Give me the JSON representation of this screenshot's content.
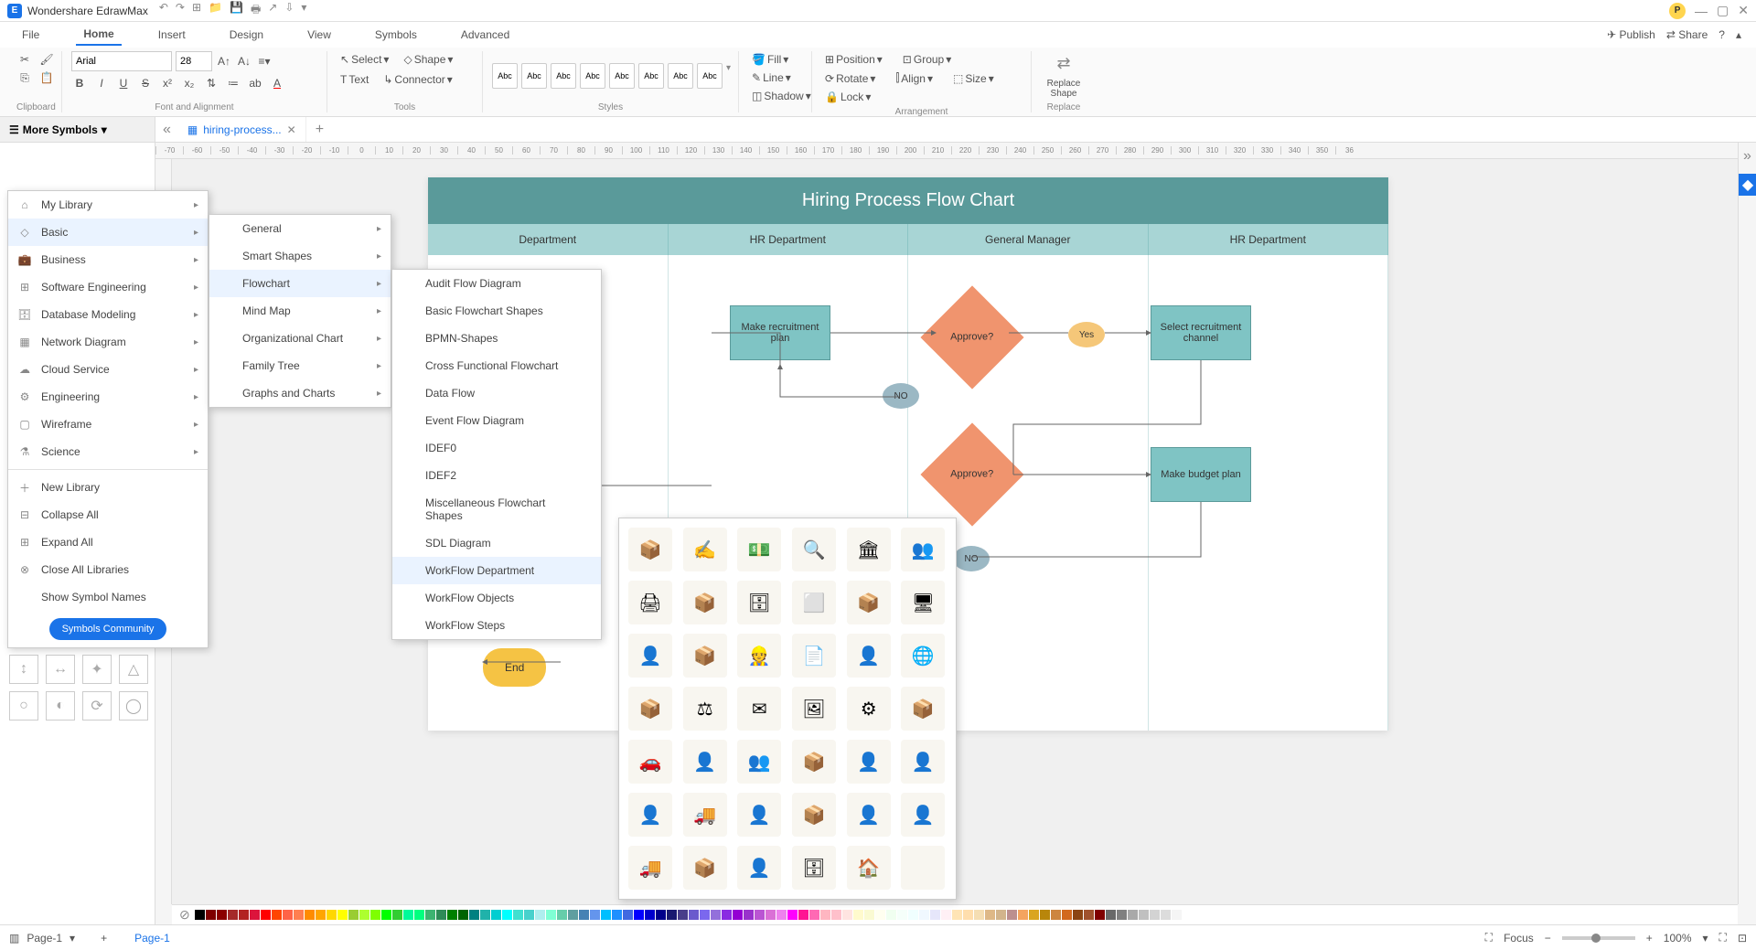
{
  "app_title": "Wondershare EdrawMax",
  "avatar_letter": "P",
  "menu_tabs": {
    "file": "File",
    "home": "Home",
    "insert": "Insert",
    "design": "Design",
    "view": "View",
    "symbols": "Symbols",
    "advanced": "Advanced",
    "publish": "Publish",
    "share": "Share"
  },
  "ribbon": {
    "clipboard": "Clipboard",
    "font_name": "Arial",
    "font_size": "28",
    "font_alignment": "Font and Alignment",
    "select": "Select",
    "shape": "Shape",
    "text": "Text",
    "connector": "Connector",
    "tools": "Tools",
    "abc": "Abc",
    "styles": "Styles",
    "fill": "Fill",
    "line": "Line",
    "shadow": "Shadow",
    "position": "Position",
    "align": "Align",
    "group": "Group",
    "size": "Size",
    "rotate": "Rotate",
    "lock": "Lock",
    "arrangement": "Arrangement",
    "replace_shape": "Replace Shape",
    "replace": "Replace"
  },
  "more_symbols": "More Symbols",
  "doc_tab": "hiring-process...",
  "library_menu": {
    "my_library": "My Library",
    "basic": "Basic",
    "business": "Business",
    "software_engineering": "Software Engineering",
    "database_modeling": "Database Modeling",
    "network_diagram": "Network Diagram",
    "cloud_service": "Cloud Service",
    "engineering": "Engineering",
    "wireframe": "Wireframe",
    "science": "Science",
    "new_library": "New Library",
    "collapse_all": "Collapse All",
    "expand_all": "Expand All",
    "close_all": "Close All Libraries",
    "show_names": "Show Symbol Names",
    "symbols_community": "Symbols Community"
  },
  "basic_submenu": {
    "general": "General",
    "smart_shapes": "Smart Shapes",
    "flowchart": "Flowchart",
    "mind_map": "Mind Map",
    "org_chart": "Organizational Chart",
    "family_tree": "Family Tree",
    "graphs_charts": "Graphs and Charts"
  },
  "flowchart_submenu": {
    "audit": "Audit Flow Diagram",
    "basic_shapes": "Basic Flowchart Shapes",
    "bpmn": "BPMN-Shapes",
    "cross_func": "Cross Functional Flowchart",
    "data_flow": "Data Flow",
    "event_flow": "Event Flow Diagram",
    "idef0": "IDEF0",
    "idef2": "IDEF2",
    "misc": "Miscellaneous Flowchart Shapes",
    "sdl": "SDL Diagram",
    "workflow_dept": "WorkFlow Department",
    "workflow_obj": "WorkFlow Objects",
    "workflow_steps": "WorkFlow Steps"
  },
  "chart": {
    "title": "Hiring Process Flow Chart",
    "lanes": [
      "Department",
      "HR Department",
      "General Manager",
      "HR Department"
    ],
    "box_make_plan": "Make recruitment plan",
    "box_select_channel": "Select recruitment channel",
    "box_make_budget": "Make budget plan",
    "diamond_approve": "Approve?",
    "yes": "Yes",
    "no": "NO",
    "end": "End"
  },
  "status": {
    "page": "Page-1",
    "focus": "Focus",
    "zoom": "100%"
  },
  "ruler_values": [
    "-70",
    "-60",
    "-50",
    "-40",
    "-30",
    "-20",
    "-10",
    "0",
    "10",
    "20",
    "30",
    "40",
    "50",
    "60",
    "70",
    "80",
    "90",
    "100",
    "110",
    "120",
    "130",
    "140",
    "150",
    "160",
    "170",
    "180",
    "190",
    "200",
    "210",
    "220",
    "230",
    "240",
    "250",
    "260",
    "270",
    "280",
    "290",
    "300",
    "310",
    "320",
    "330",
    "340",
    "350",
    "36"
  ],
  "colors": [
    "#000000",
    "#7f0000",
    "#8b0000",
    "#a52a2a",
    "#b22222",
    "#dc143c",
    "#ff0000",
    "#ff4500",
    "#ff6347",
    "#ff7f50",
    "#ff8c00",
    "#ffa500",
    "#ffd700",
    "#ffff00",
    "#9acd32",
    "#adff2f",
    "#7fff00",
    "#00ff00",
    "#32cd32",
    "#00fa9a",
    "#00ff7f",
    "#3cb371",
    "#2e8b57",
    "#008000",
    "#006400",
    "#008080",
    "#20b2aa",
    "#00ced1",
    "#00ffff",
    "#40e0d0",
    "#48d1cc",
    "#afeeee",
    "#7fffd4",
    "#66cdaa",
    "#5f9ea0",
    "#4682b4",
    "#6495ed",
    "#00bfff",
    "#1e90ff",
    "#4169e1",
    "#0000ff",
    "#0000cd",
    "#00008b",
    "#191970",
    "#483d8b",
    "#6a5acd",
    "#7b68ee",
    "#9370db",
    "#8a2be2",
    "#9400d3",
    "#9932cc",
    "#ba55d3",
    "#da70d6",
    "#ee82ee",
    "#ff00ff",
    "#ff1493",
    "#ff69b4",
    "#ffb6c1",
    "#ffc0cb",
    "#ffe4e1",
    "#fffacd",
    "#fafad2",
    "#fffff0",
    "#f0fff0",
    "#f5fffa",
    "#f0ffff",
    "#f0f8ff",
    "#e6e6fa",
    "#fff0f5",
    "#ffe4b5",
    "#ffdead",
    "#f5deb3",
    "#deb887",
    "#d2b48c",
    "#bc8f8f",
    "#f4a460",
    "#daa520",
    "#b8860b",
    "#cd853f",
    "#d2691e",
    "#8b4513",
    "#a0522d",
    "#800000",
    "#696969",
    "#808080",
    "#a9a9a9",
    "#c0c0c0",
    "#d3d3d3",
    "#dcdcdc",
    "#f5f5f5",
    "#ffffff"
  ]
}
